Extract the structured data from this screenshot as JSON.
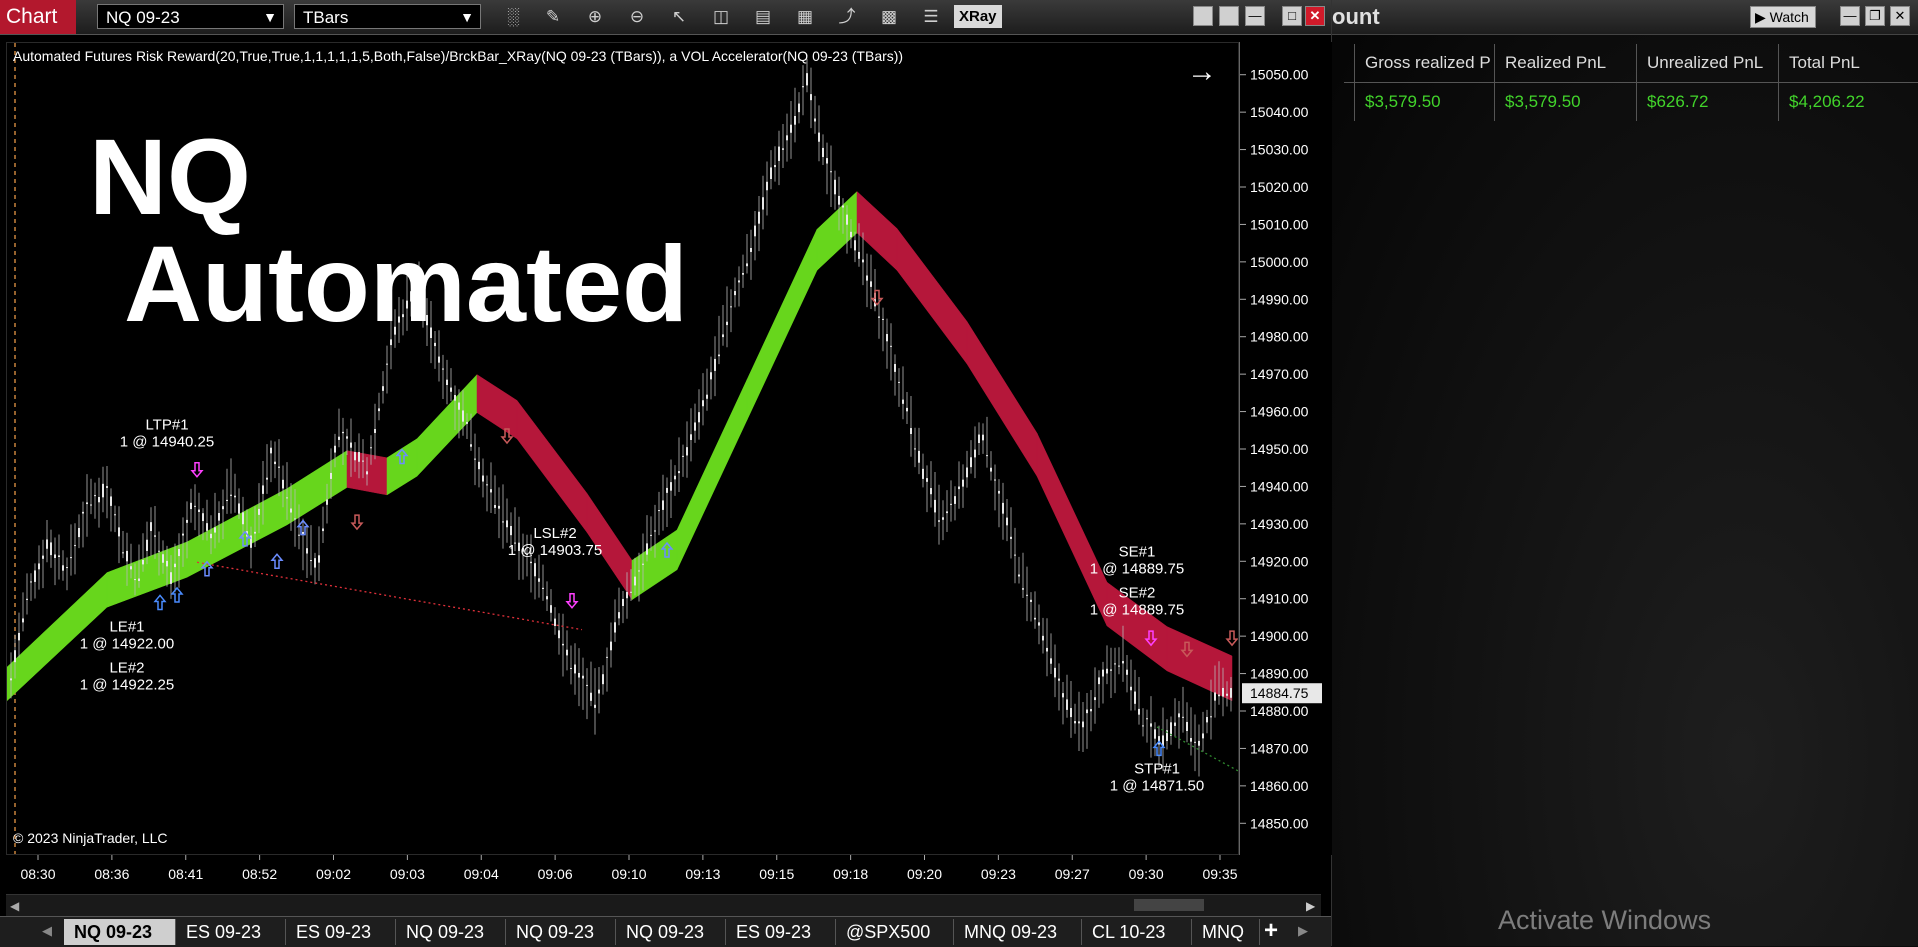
{
  "chart_window": {
    "title": "Chart",
    "instrument": "NQ 09-23",
    "bar_type": "TBars",
    "xray_label": "XRay",
    "indicator_line": "Automated Futures Risk Reward(20,True,True,1,1,1,1,1,5,Both,False)/BrckBar_XRay(NQ 09-23 (TBars)), a VOL Accelerator(NQ 09-23 (TBars))",
    "overlay_line1": "NQ",
    "overlay_line2": "Automated",
    "copyright": "© 2023 NinjaTrader, LLC",
    "toolbar_icons": [
      "bar-style-icon",
      "draw-pencil-icon",
      "zoom-in-icon",
      "zoom-out-icon",
      "pointer-icon",
      "data-box-icon",
      "properties-icon",
      "indicators-icon",
      "strategies-icon",
      "templates-icon",
      "list-icon"
    ],
    "window_buttons": [
      "minimize",
      "maximize",
      "restore",
      "close"
    ]
  },
  "price_axis": {
    "ticks": [
      "15050.00",
      "15040.00",
      "15030.00",
      "15020.00",
      "15010.00",
      "15000.00",
      "14990.00",
      "14980.00",
      "14970.00",
      "14960.00",
      "14950.00",
      "14940.00",
      "14930.00",
      "14920.00",
      "14910.00",
      "14900.00",
      "14890.00",
      "14880.00",
      "14870.00",
      "14860.00",
      "14850.00"
    ],
    "current_price": "14884.75"
  },
  "time_axis": {
    "ticks": [
      "08:30",
      "08:36",
      "08:41",
      "08:52",
      "09:02",
      "09:03",
      "09:04",
      "09:06",
      "09:10",
      "09:13",
      "09:15",
      "09:18",
      "09:20",
      "09:23",
      "09:27",
      "09:30",
      "09:35"
    ]
  },
  "chart_data": {
    "type": "line",
    "ylim": [
      14845,
      15055
    ],
    "price_path": [
      {
        "x": 0,
        "y": 14885
      },
      {
        "x": 20,
        "y": 14910
      },
      {
        "x": 40,
        "y": 14925
      },
      {
        "x": 60,
        "y": 14918
      },
      {
        "x": 80,
        "y": 14935
      },
      {
        "x": 100,
        "y": 14940
      },
      {
        "x": 115,
        "y": 14925
      },
      {
        "x": 130,
        "y": 14915
      },
      {
        "x": 145,
        "y": 14930
      },
      {
        "x": 165,
        "y": 14915
      },
      {
        "x": 185,
        "y": 14935
      },
      {
        "x": 205,
        "y": 14928
      },
      {
        "x": 225,
        "y": 14940
      },
      {
        "x": 245,
        "y": 14925
      },
      {
        "x": 265,
        "y": 14950
      },
      {
        "x": 290,
        "y": 14930
      },
      {
        "x": 310,
        "y": 14918
      },
      {
        "x": 330,
        "y": 14955
      },
      {
        "x": 360,
        "y": 14945
      },
      {
        "x": 385,
        "y": 14980
      },
      {
        "x": 410,
        "y": 14995
      },
      {
        "x": 430,
        "y": 14975
      },
      {
        "x": 455,
        "y": 14960
      },
      {
        "x": 480,
        "y": 14940
      },
      {
        "x": 510,
        "y": 14925
      },
      {
        "x": 535,
        "y": 14915
      },
      {
        "x": 560,
        "y": 14895
      },
      {
        "x": 590,
        "y": 14882
      },
      {
        "x": 610,
        "y": 14905
      },
      {
        "x": 635,
        "y": 14920
      },
      {
        "x": 655,
        "y": 14935
      },
      {
        "x": 680,
        "y": 14950
      },
      {
        "x": 700,
        "y": 14965
      },
      {
        "x": 720,
        "y": 14985
      },
      {
        "x": 745,
        "y": 15005
      },
      {
        "x": 765,
        "y": 15025
      },
      {
        "x": 790,
        "y": 15040
      },
      {
        "x": 800,
        "y": 15049
      },
      {
        "x": 815,
        "y": 15030
      },
      {
        "x": 835,
        "y": 15015
      },
      {
        "x": 855,
        "y": 15000
      },
      {
        "x": 875,
        "y": 14985
      },
      {
        "x": 895,
        "y": 14965
      },
      {
        "x": 915,
        "y": 14945
      },
      {
        "x": 935,
        "y": 14930
      },
      {
        "x": 955,
        "y": 14940
      },
      {
        "x": 975,
        "y": 14955
      },
      {
        "x": 995,
        "y": 14935
      },
      {
        "x": 1015,
        "y": 14915
      },
      {
        "x": 1035,
        "y": 14900
      },
      {
        "x": 1055,
        "y": 14885
      },
      {
        "x": 1075,
        "y": 14875
      },
      {
        "x": 1095,
        "y": 14890
      },
      {
        "x": 1115,
        "y": 14895
      },
      {
        "x": 1135,
        "y": 14878
      },
      {
        "x": 1155,
        "y": 14872
      },
      {
        "x": 1175,
        "y": 14880
      },
      {
        "x": 1190,
        "y": 14870
      },
      {
        "x": 1210,
        "y": 14885
      },
      {
        "x": 1225,
        "y": 14884.75
      }
    ],
    "ribbon": [
      {
        "x": 0,
        "y": 14885,
        "color": "#67d61c"
      },
      {
        "x": 100,
        "y": 14910,
        "color": "#67d61c"
      },
      {
        "x": 180,
        "y": 14918,
        "color": "#67d61c"
      },
      {
        "x": 280,
        "y": 14932,
        "color": "#67d61c"
      },
      {
        "x": 340,
        "y": 14942,
        "color": "#67d61c"
      },
      {
        "x": 380,
        "y": 14940,
        "color": "#b5173a"
      },
      {
        "x": 410,
        "y": 14945,
        "color": "#67d61c"
      },
      {
        "x": 470,
        "y": 14962,
        "color": "#67d61c"
      },
      {
        "x": 510,
        "y": 14955,
        "color": "#b5173a"
      },
      {
        "x": 580,
        "y": 14930,
        "color": "#b5173a"
      },
      {
        "x": 625,
        "y": 14912,
        "color": "#b5173a"
      },
      {
        "x": 670,
        "y": 14920,
        "color": "#67d61c"
      },
      {
        "x": 740,
        "y": 14960,
        "color": "#67d61c"
      },
      {
        "x": 810,
        "y": 15000,
        "color": "#67d61c"
      },
      {
        "x": 850,
        "y": 15010,
        "color": "#67d61c"
      },
      {
        "x": 890,
        "y": 15000,
        "color": "#b5173a"
      },
      {
        "x": 960,
        "y": 14975,
        "color": "#b5173a"
      },
      {
        "x": 1030,
        "y": 14945,
        "color": "#b5173a"
      },
      {
        "x": 1100,
        "y": 14905,
        "color": "#b5173a"
      },
      {
        "x": 1160,
        "y": 14893,
        "color": "#b5173a"
      },
      {
        "x": 1225,
        "y": 14885,
        "color": "#b5173a"
      }
    ],
    "annotations": [
      {
        "label": "LTP#1",
        "sub": "1 @ 14940.25",
        "x": 160,
        "y": 14955,
        "color": "#ffffff"
      },
      {
        "label": "LE#1",
        "sub": "1 @ 14922.00",
        "x": 120,
        "y": 14901,
        "color": "#ffffff"
      },
      {
        "label": "LE#2",
        "sub": "1 @ 14922.25",
        "x": 120,
        "y": 14890,
        "color": "#ffffff"
      },
      {
        "label": "LSL#2",
        "sub": "1 @ 14903.75",
        "x": 548,
        "y": 14926,
        "color": "#ffffff"
      },
      {
        "label": "SE#1",
        "sub": "1 @ 14889.75",
        "x": 1130,
        "y": 14921,
        "color": "#ffffff"
      },
      {
        "label": "SE#2",
        "sub": "1 @ 14889.75",
        "x": 1130,
        "y": 14910,
        "color": "#ffffff"
      },
      {
        "label": "STP#1",
        "sub": "1 @ 14871.50",
        "x": 1150,
        "y": 14863,
        "color": "#ffffff"
      }
    ],
    "arrows": [
      {
        "x": 153,
        "y": 14909,
        "dir": "up",
        "color": "#4a8cff"
      },
      {
        "x": 170,
        "y": 14911,
        "dir": "up",
        "color": "#4a8cff"
      },
      {
        "x": 200,
        "y": 14918,
        "dir": "up",
        "color": "#6b8cff"
      },
      {
        "x": 238,
        "y": 14926,
        "dir": "up",
        "color": "#6b8cff"
      },
      {
        "x": 270,
        "y": 14920,
        "dir": "up",
        "color": "#6b8cff"
      },
      {
        "x": 296,
        "y": 14929,
        "dir": "up",
        "color": "#6b8cff"
      },
      {
        "x": 395,
        "y": 14948,
        "dir": "up",
        "color": "#6b8cff"
      },
      {
        "x": 660,
        "y": 14923,
        "dir": "up",
        "color": "#6b8cff"
      },
      {
        "x": 1152,
        "y": 14870,
        "dir": "up",
        "color": "#4a8cff"
      },
      {
        "x": 190,
        "y": 14945,
        "dir": "down",
        "color": "#ff40ff"
      },
      {
        "x": 565,
        "y": 14910,
        "dir": "down",
        "color": "#ff40ff"
      },
      {
        "x": 1144,
        "y": 14900,
        "dir": "down",
        "color": "#ff40ff"
      },
      {
        "x": 350,
        "y": 14931,
        "dir": "down",
        "color": "#c85a5a"
      },
      {
        "x": 500,
        "y": 14954,
        "dir": "down",
        "color": "#c85a5a"
      },
      {
        "x": 870,
        "y": 14991,
        "dir": "down",
        "color": "#c85a5a"
      },
      {
        "x": 1180,
        "y": 14897,
        "dir": "down",
        "color": "#c85a5a"
      },
      {
        "x": 1225,
        "y": 14900,
        "dir": "down",
        "color": "#c85a5a"
      }
    ],
    "stop_line": [
      {
        "x": 190,
        "y": 14920
      },
      {
        "x": 575,
        "y": 14902
      }
    ]
  },
  "tabs": [
    "NQ 09-23",
    "ES 09-23",
    "ES 09-23",
    "NQ 09-23",
    "NQ 09-23",
    "NQ 09-23",
    "ES 09-23",
    "@SPX500",
    "MNQ 09-23",
    "CL 10-23",
    "MNQ"
  ],
  "tab_add": "+",
  "account_window": {
    "title": "ount",
    "watch_label": "Watch",
    "headers": [
      "Gross realized P",
      "Realized PnL",
      "Unrealized PnL",
      "Total PnL"
    ],
    "values": [
      "$3,579.50",
      "$3,579.50",
      "$626.72",
      "$4,206.22"
    ]
  },
  "watermark": "Activate Windows"
}
